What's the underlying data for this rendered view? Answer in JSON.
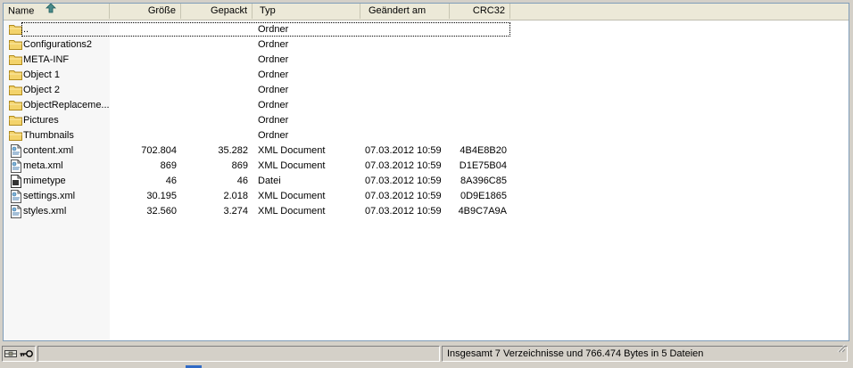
{
  "columns": {
    "name": "Name",
    "size": "Größe",
    "packed": "Gepackt",
    "type": "Typ",
    "modified": "Geändert am",
    "crc": "CRC32"
  },
  "rows": [
    {
      "icon": "folder-up-icon",
      "name": "..",
      "size": "",
      "packed": "",
      "type": "Ordner",
      "modified": "",
      "crc": ""
    },
    {
      "icon": "folder-icon",
      "name": "Configurations2",
      "size": "",
      "packed": "",
      "type": "Ordner",
      "modified": "",
      "crc": ""
    },
    {
      "icon": "folder-icon",
      "name": "META-INF",
      "size": "",
      "packed": "",
      "type": "Ordner",
      "modified": "",
      "crc": ""
    },
    {
      "icon": "folder-icon",
      "name": "Object 1",
      "size": "",
      "packed": "",
      "type": "Ordner",
      "modified": "",
      "crc": ""
    },
    {
      "icon": "folder-icon",
      "name": "Object 2",
      "size": "",
      "packed": "",
      "type": "Ordner",
      "modified": "",
      "crc": ""
    },
    {
      "icon": "folder-icon",
      "name": "ObjectReplaceme...",
      "size": "",
      "packed": "",
      "type": "Ordner",
      "modified": "",
      "crc": ""
    },
    {
      "icon": "folder-icon",
      "name": "Pictures",
      "size": "",
      "packed": "",
      "type": "Ordner",
      "modified": "",
      "crc": ""
    },
    {
      "icon": "folder-icon",
      "name": "Thumbnails",
      "size": "",
      "packed": "",
      "type": "Ordner",
      "modified": "",
      "crc": ""
    },
    {
      "icon": "xml-file-icon",
      "name": "content.xml",
      "size": "702.804",
      "packed": "35.282",
      "type": "XML Document",
      "modified": "07.03.2012 10:59",
      "crc": "4B4E8B20"
    },
    {
      "icon": "xml-file-icon",
      "name": "meta.xml",
      "size": "869",
      "packed": "869",
      "type": "XML Document",
      "modified": "07.03.2012 10:59",
      "crc": "D1E75B04"
    },
    {
      "icon": "generic-file-icon",
      "name": "mimetype",
      "size": "46",
      "packed": "46",
      "type": "Datei",
      "modified": "07.03.2012 10:59",
      "crc": "8A396C85"
    },
    {
      "icon": "xml-file-icon",
      "name": "settings.xml",
      "size": "30.195",
      "packed": "2.018",
      "type": "XML Document",
      "modified": "07.03.2012 10:59",
      "crc": "0D9E1865"
    },
    {
      "icon": "xml-file-icon",
      "name": "styles.xml",
      "size": "32.560",
      "packed": "3.274",
      "type": "XML Document",
      "modified": "07.03.2012 10:59",
      "crc": "4B9C7A9A"
    }
  ],
  "status": {
    "left_icons": [
      "archive-icon",
      "key-icon"
    ],
    "summary": "Insgesamt 7 Verzeichnisse und 766.474 Bytes in 5 Dateien"
  },
  "colors": {
    "chrome": "#d4d0c8",
    "header": "#ece9d8",
    "folder": "#f3d36b"
  }
}
